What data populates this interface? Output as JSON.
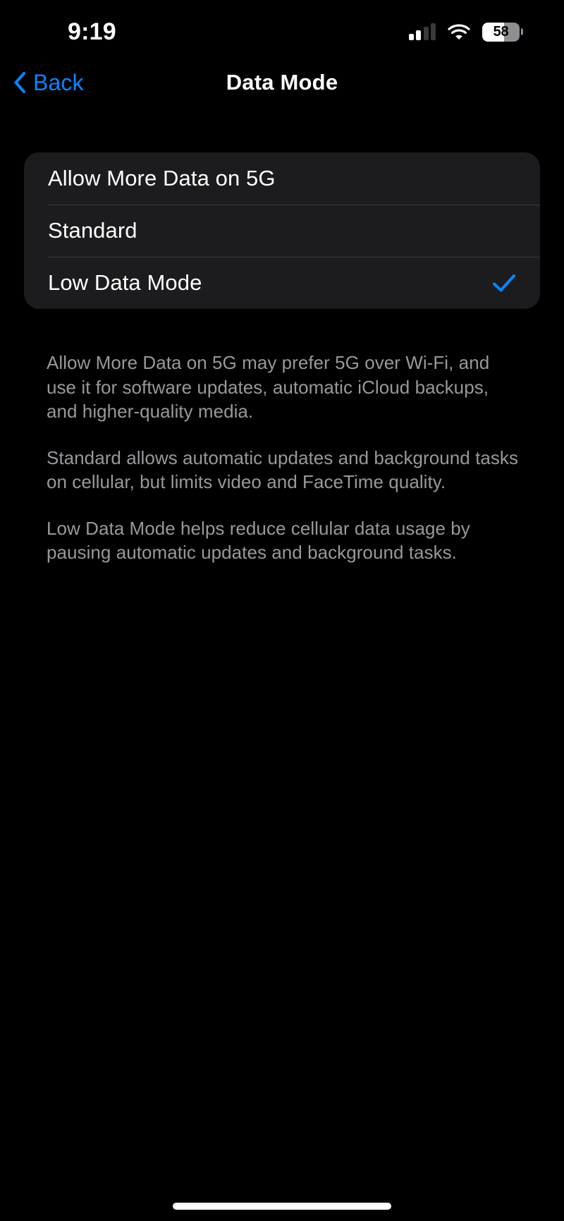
{
  "status_bar": {
    "time": "9:19",
    "cellular_icon": "cellular-bars-icon",
    "cellular_bars_filled": 2,
    "cellular_bars_total": 4,
    "wifi_icon": "wifi-icon",
    "battery_icon": "battery-icon",
    "battery_percent_label": "58",
    "battery_percent": 58
  },
  "nav_bar": {
    "back_label": "Back",
    "back_icon": "chevron-left-icon",
    "title": "Data Mode"
  },
  "options": {
    "rows": [
      {
        "label": "Allow More Data on 5G",
        "selected": false,
        "check_icon": "checkmark-icon"
      },
      {
        "label": "Standard",
        "selected": false,
        "check_icon": "checkmark-icon"
      },
      {
        "label": "Low Data Mode",
        "selected": true,
        "check_icon": "checkmark-icon"
      }
    ],
    "selected_value": "Low Data Mode"
  },
  "footnotes": [
    "Allow More Data on 5G may prefer 5G over Wi-Fi, and use it for software updates, automatic iCloud backups, and higher-quality media.",
    "Standard allows automatic updates and background tasks on cellular, but limits video and FaceTime quality.",
    "Low Data Mode helps reduce cellular data usage by pausing automatic updates and background tasks."
  ],
  "home_indicator": "home-indicator",
  "colors": {
    "accent": "#0a84ff",
    "background": "#000000",
    "card": "#1c1c1e",
    "separator": "#38383a",
    "secondary_text": "#98989d",
    "primary_text": "#ffffff",
    "battery_track": "#8e8e93"
  }
}
